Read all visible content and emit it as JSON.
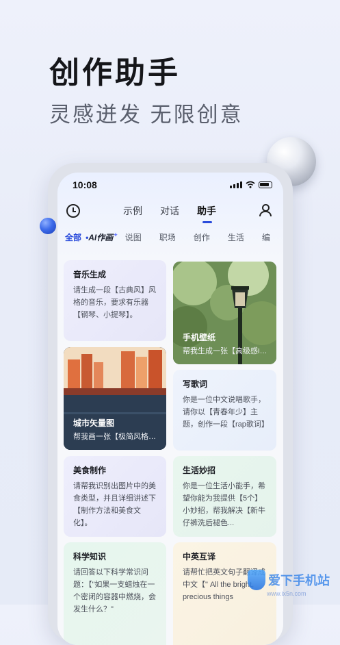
{
  "hero": {
    "title": "创作助手",
    "subtitle": "灵感迸发 无限创意"
  },
  "status_bar": {
    "time": "10:08"
  },
  "nav": {
    "tabs": [
      "示例",
      "对话",
      "助手"
    ],
    "active_tab": "助手"
  },
  "categories": [
    "全部",
    "AI作画",
    "说图",
    "职场",
    "创作",
    "生活",
    "编"
  ],
  "accent_color": "#2a4bdb",
  "cards": {
    "music": {
      "title": "音乐生成",
      "desc": "请生成一段【古典风】风格的音乐，要求有乐器【钢琴、小提琴】。"
    },
    "wallpaper": {
      "title": "手机壁纸",
      "desc": "帮我生成一张【高级感in..."
    },
    "city": {
      "title": "城市矢量图",
      "desc": "帮我画一张【极简风格秋..."
    },
    "lyrics": {
      "title": "写歌词",
      "desc": "你是一位中文说唱歌手，请你以【青春年少】主题，创作一段【rap歌词】"
    },
    "food": {
      "title": "美食制作",
      "desc": "请帮我识别出图片中的美食类型，并且详细讲述下【制作方法和美食文化】。"
    },
    "tips": {
      "title": "生活妙招",
      "desc": "你是一位生活小能手，希望你能为我提供【5个】小妙招，帮我解决【新牛仔裤洗后褪色..."
    },
    "science": {
      "title": "科学知识",
      "desc": "请回答以下科学常识问题：【\"如果一支蜡烛在一个密闭的容器中燃烧，会发生什么？\""
    },
    "translate": {
      "title": "中英互译",
      "desc": "请帮忙把英文句子翻译成中文【\" All the bright, precious things"
    }
  },
  "watermark": {
    "text": "爱下手机站",
    "url": "www.ix5n.com"
  }
}
